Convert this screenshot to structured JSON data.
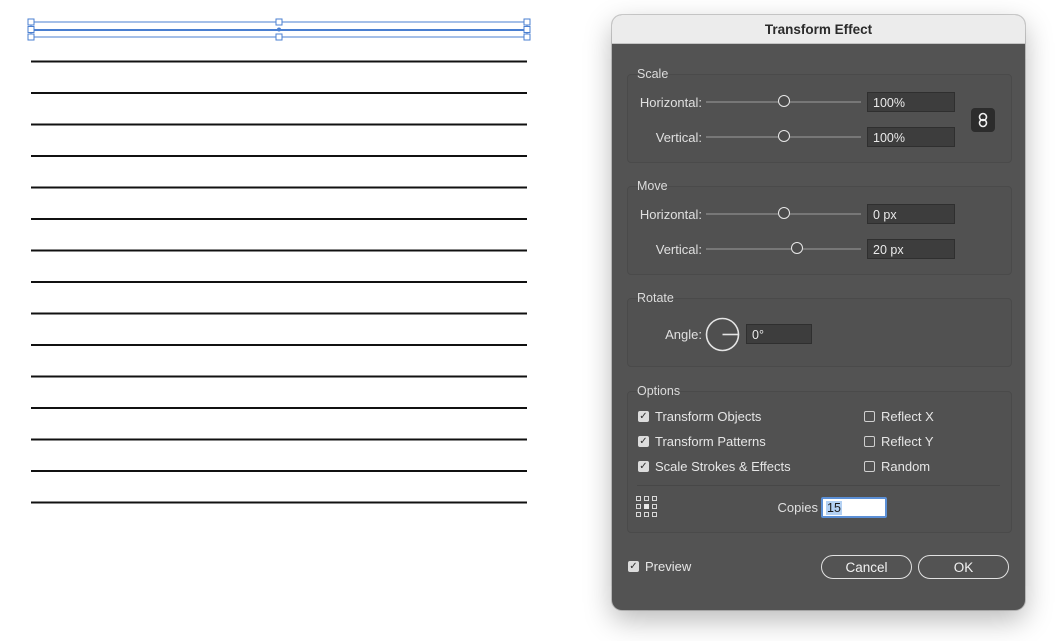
{
  "artboard": {
    "lines_drawn": 16,
    "selected_line": 1
  },
  "dialog": {
    "title": "Transform Effect",
    "scale": {
      "group_label": "Scale",
      "horizontal_label": "Horizontal:",
      "horizontal_value": "100%",
      "vertical_label": "Vertical:",
      "vertical_value": "100%",
      "link_icon": "link-icon"
    },
    "move": {
      "group_label": "Move",
      "horizontal_label": "Horizontal:",
      "horizontal_value": "0 px",
      "vertical_label": "Vertical:",
      "vertical_value": "20 px"
    },
    "rotate": {
      "group_label": "Rotate",
      "angle_label": "Angle:",
      "angle_value": "0°"
    },
    "options": {
      "group_label": "Options",
      "transform_objects": "Transform Objects",
      "transform_patterns": "Transform Patterns",
      "scale_strokes": "Scale Strokes & Effects",
      "reflect_x": "Reflect X",
      "reflect_y": "Reflect Y",
      "random": "Random",
      "checked": {
        "transform_objects": true,
        "transform_patterns": true,
        "scale_strokes": true,
        "reflect_x": false,
        "reflect_y": false,
        "random": false
      },
      "copies_label": "Copies",
      "copies_value": "15",
      "reference_point_icon": "reference-point-icon"
    },
    "preview_label": "Preview",
    "preview_checked": true,
    "cancel_label": "Cancel",
    "ok_label": "OK",
    "colors": {
      "dialog_bg": "#535353",
      "selection": "#4a7fd1"
    }
  }
}
